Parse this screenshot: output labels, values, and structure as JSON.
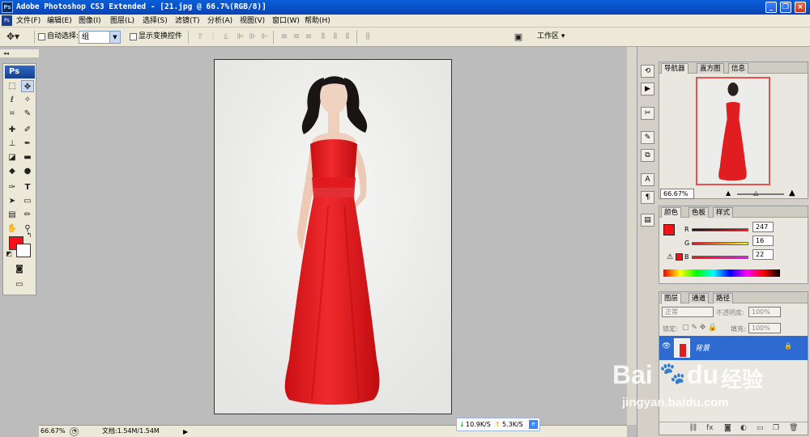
{
  "window": {
    "title": "Adobe Photoshop CS3 Extended - [21.jpg @ 66.7%(RGB/8)]",
    "app_icon": "Ps",
    "buttons": {
      "minimize": "_",
      "restore": "❐",
      "close": "×"
    }
  },
  "menubar": {
    "icon": "Ps",
    "items": [
      "文件(F)",
      "编辑(E)",
      "图像(I)",
      "图层(L)",
      "选择(S)",
      "滤镜(T)",
      "分析(A)",
      "视图(V)",
      "窗口(W)",
      "帮助(H)"
    ]
  },
  "options": {
    "auto_select_label": "自动选择:",
    "auto_select_value": "组",
    "show_transform_label": "显示变换控件",
    "workspace_label": "工作区 ▾"
  },
  "toolbox": {
    "logo": "Ps",
    "fg_color": "#f71016",
    "bg_color": "#ffffff"
  },
  "status": {
    "zoom": "66.67%",
    "doc_info": "文档:1.54M/1.54M"
  },
  "network": {
    "down": "10.9K/S",
    "up": "5.3K/S"
  },
  "navigator": {
    "tabs": [
      "导航器",
      "直方图",
      "信息"
    ],
    "zoom": "66.67%"
  },
  "color_panel": {
    "tabs": [
      "颜色",
      "色板",
      "样式"
    ],
    "channels": [
      {
        "label": "R",
        "value": "247"
      },
      {
        "label": "G",
        "value": "16"
      },
      {
        "label": "B",
        "value": "22"
      }
    ],
    "swatch": "#f71016"
  },
  "layers_panel": {
    "tabs": [
      "图层",
      "通道",
      "路径"
    ],
    "blend_mode": "正常",
    "opacity_label": "不透明度:",
    "opacity_value": "100%",
    "lock_label": "锁定:",
    "fill_label": "填充:",
    "fill_value": "100%",
    "layer_name": "背景"
  },
  "watermark": {
    "brand": "Bai",
    "brand2": "du",
    "sub": "经验",
    "url": "jingyan.baidu.com"
  }
}
